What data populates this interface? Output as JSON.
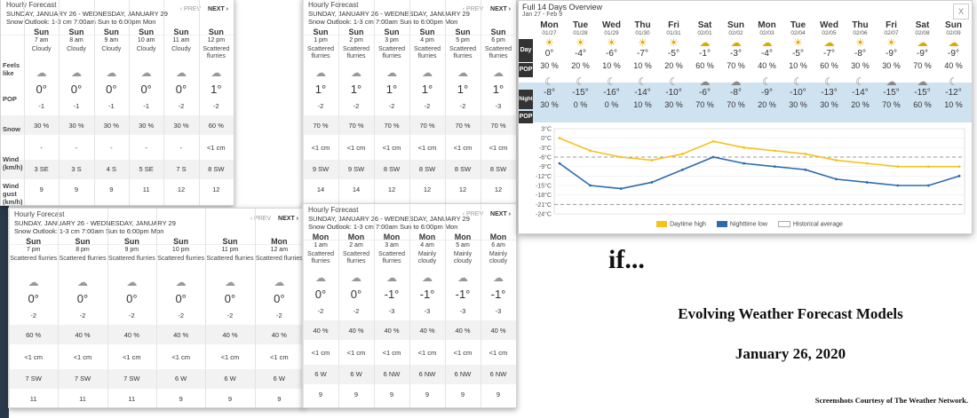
{
  "panels": [
    {
      "title": "Hourly Forecast",
      "dates": "SUNDAY, JANUARY 26 - WEDNESDAY, JANUARY 29",
      "outlook": "Snow Outlook: 1-3 cm 7:00am Sun to 6:00pm Mon",
      "prev": "‹ PREV",
      "next": "NEXT ›",
      "labels": {
        "feels": "Feels like",
        "pop": "POP",
        "snow": "Snow",
        "wind": "Wind (km/h)",
        "gust": "Wind gust (km/h)"
      },
      "hours": [
        {
          "day": "Sun",
          "time": "7 am",
          "cond": "Cloudy",
          "feels": "0°",
          "pop_val": "-1",
          "snow": "30 %",
          "snow2": "-",
          "wind": "3 SE",
          "gust": "9"
        },
        {
          "day": "Sun",
          "time": "8 am",
          "cond": "Cloudy",
          "feels": "0°",
          "pop_val": "-1",
          "snow": "30 %",
          "snow2": "-",
          "wind": "3 S",
          "gust": "9"
        },
        {
          "day": "Sun",
          "time": "9 am",
          "cond": "Cloudy",
          "feels": "0°",
          "pop_val": "-1",
          "snow": "30 %",
          "snow2": "-",
          "wind": "4 S",
          "gust": "9"
        },
        {
          "day": "Sun",
          "time": "10 am",
          "cond": "Cloudy",
          "feels": "0°",
          "pop_val": "-1",
          "snow": "30 %",
          "snow2": "-",
          "wind": "5 SE",
          "gust": "11"
        },
        {
          "day": "Sun",
          "time": "11 am",
          "cond": "Cloudy",
          "feels": "0°",
          "pop_val": "-2",
          "snow": "30 %",
          "snow2": "-",
          "wind": "7 S",
          "gust": "12"
        },
        {
          "day": "Sun",
          "time": "12 pm",
          "cond": "Scattered flurries",
          "feels": "1°",
          "pop_val": "-2",
          "snow": "60 %",
          "snow2": "<1 cm",
          "wind": "8 SW",
          "gust": "12"
        }
      ]
    },
    {
      "title": "Hourly Forecast",
      "dates": "SUNDAY, JANUARY 26 - WEDNESDAY, JANUARY 29",
      "outlook": "Snow Outlook: 1-3 cm 7:00am Sun to 6:00pm Mon",
      "prev": "‹ PREV",
      "next": "NEXT ›",
      "hours": [
        {
          "day": "Sun",
          "time": "1 pm",
          "cond": "Scattered flurries",
          "feels": "1°",
          "pop_val": "-2",
          "snow": "70 %",
          "snow2": "<1 cm",
          "wind": "9 SW",
          "gust": "14"
        },
        {
          "day": "Sun",
          "time": "2 pm",
          "cond": "Scattered flurries",
          "feels": "1°",
          "pop_val": "-2",
          "snow": "70 %",
          "snow2": "<1 cm",
          "wind": "9 SW",
          "gust": "14"
        },
        {
          "day": "Sun",
          "time": "3 pm",
          "cond": "Scattered flurries",
          "feels": "1°",
          "pop_val": "-2",
          "snow": "70 %",
          "snow2": "<1 cm",
          "wind": "8 SW",
          "gust": "12"
        },
        {
          "day": "Sun",
          "time": "4 pm",
          "cond": "Scattered flurries",
          "feels": "1°",
          "pop_val": "-2",
          "snow": "70 %",
          "snow2": "<1 cm",
          "wind": "8 SW",
          "gust": "12"
        },
        {
          "day": "Sun",
          "time": "5 pm",
          "cond": "Scattered flurries",
          "feels": "1°",
          "pop_val": "-2",
          "snow": "70 %",
          "snow2": "<1 cm",
          "wind": "8 SW",
          "gust": "12"
        },
        {
          "day": "Sun",
          "time": "6 pm",
          "cond": "Scattered flurries",
          "feels": "1°",
          "pop_val": "-3",
          "snow": "70 %",
          "snow2": "<1 cm",
          "wind": "8 SW",
          "gust": "12"
        }
      ]
    },
    {
      "title": "Hourly Forecast",
      "dates": "SUNDAY, JANUARY 26 - WEDNESDAY, JANUARY 29",
      "outlook": "Snow Outlook: 1-3 cm 7:00am Sun to 6:00pm Mon",
      "prev": "‹ PREV",
      "next": "NEXT ›",
      "hours": [
        {
          "day": "Sun",
          "time": "7 pm",
          "cond": "Scattered flurries",
          "feels": "0°",
          "pop_val": "-2",
          "snow": "60 %",
          "snow2": "<1 cm",
          "wind": "7 SW",
          "gust": "11"
        },
        {
          "day": "Sun",
          "time": "8 pm",
          "cond": "Scattered flurries",
          "feels": "0°",
          "pop_val": "-2",
          "snow": "40 %",
          "snow2": "<1 cm",
          "wind": "7 SW",
          "gust": "11"
        },
        {
          "day": "Sun",
          "time": "9 pm",
          "cond": "Scattered flurries",
          "feels": "0°",
          "pop_val": "-2",
          "snow": "40 %",
          "snow2": "<1 cm",
          "wind": "7 SW",
          "gust": "11"
        },
        {
          "day": "Sun",
          "time": "10 pm",
          "cond": "Scattered flurries",
          "feels": "0°",
          "pop_val": "-2",
          "snow": "40 %",
          "snow2": "<1 cm",
          "wind": "6 W",
          "gust": "9"
        },
        {
          "day": "Sun",
          "time": "11 pm",
          "cond": "Scattered flurries",
          "feels": "0°",
          "pop_val": "-2",
          "snow": "40 %",
          "snow2": "<1 cm",
          "wind": "6 W",
          "gust": "9"
        },
        {
          "day": "Mon",
          "time": "12 am",
          "cond": "Scattered flurries",
          "feels": "0°",
          "pop_val": "-2",
          "snow": "40 %",
          "snow2": "<1 cm",
          "wind": "6 W",
          "gust": "9"
        }
      ]
    },
    {
      "title": "Hourly Forecast",
      "dates": "SUNDAY, JANUARY 26 - WEDNESDAY, JANUARY 29",
      "outlook": "Snow Outlook: 1-3 cm 7:00am Sun to 6:00pm Mon",
      "prev": "‹ PREV",
      "next": "NEXT ›",
      "hours": [
        {
          "day": "Mon",
          "time": "1 am",
          "cond": "Scattered flurries",
          "feels": "0°",
          "pop_val": "-2",
          "snow": "40 %",
          "snow2": "<1 cm",
          "wind": "6 W",
          "gust": "9"
        },
        {
          "day": "Mon",
          "time": "2 am",
          "cond": "Scattered flurries",
          "feels": "0°",
          "pop_val": "-2",
          "snow": "40 %",
          "snow2": "<1 cm",
          "wind": "6 W",
          "gust": "9"
        },
        {
          "day": "Mon",
          "time": "3 am",
          "cond": "Scattered flurries",
          "feels": "-1°",
          "pop_val": "-3",
          "snow": "40 %",
          "snow2": "<1 cm",
          "wind": "6 NW",
          "gust": "9"
        },
        {
          "day": "Mon",
          "time": "4 am",
          "cond": "Mainly cloudy",
          "feels": "-1°",
          "pop_val": "-3",
          "snow": "40 %",
          "snow2": "<1 cm",
          "wind": "6 NW",
          "gust": "9"
        },
        {
          "day": "Mon",
          "time": "5 am",
          "cond": "Mainly cloudy",
          "feels": "-1°",
          "pop_val": "-3",
          "snow": "40 %",
          "snow2": "<1 cm",
          "wind": "6 NW",
          "gust": "9"
        },
        {
          "day": "Mon",
          "time": "6 am",
          "cond": "Mainly cloudy",
          "feels": "-1°",
          "pop_val": "-3",
          "snow": "40 %",
          "snow2": "<1 cm",
          "wind": "6 NW",
          "gust": "9"
        }
      ]
    }
  ],
  "overview": {
    "title": "Full 14 Days Overview",
    "range": "Jan 27 - Feb 9",
    "close": "X",
    "day_label": "Day",
    "pop_label": "POP",
    "night_label": "Night",
    "days": [
      {
        "day": "Mon",
        "date": "01/27",
        "high": "0°",
        "pop": "30 %",
        "low": "-8°",
        "npop": "30 %"
      },
      {
        "day": "Tue",
        "date": "01/28",
        "high": "-4°",
        "pop": "20 %",
        "low": "-15°",
        "npop": "0 %"
      },
      {
        "day": "Wed",
        "date": "01/29",
        "high": "-6°",
        "pop": "10 %",
        "low": "-16°",
        "npop": "0 %"
      },
      {
        "day": "Thu",
        "date": "01/30",
        "high": "-7°",
        "pop": "10 %",
        "low": "-14°",
        "npop": "10 %"
      },
      {
        "day": "Fri",
        "date": "01/31",
        "high": "-5°",
        "pop": "20 %",
        "low": "-10°",
        "npop": "30 %"
      },
      {
        "day": "Sat",
        "date": "02/01",
        "high": "-1°",
        "pop": "60 %",
        "low": "-6°",
        "npop": "70 %"
      },
      {
        "day": "Sun",
        "date": "02/02",
        "high": "-3°",
        "pop": "70 %",
        "low": "-8°",
        "npop": "70 %"
      },
      {
        "day": "Mon",
        "date": "02/03",
        "high": "-4°",
        "pop": "40 %",
        "low": "-9°",
        "npop": "20 %"
      },
      {
        "day": "Tue",
        "date": "02/04",
        "high": "-5°",
        "pop": "10 %",
        "low": "-10°",
        "npop": "30 %"
      },
      {
        "day": "Wed",
        "date": "02/05",
        "high": "-7°",
        "pop": "60 %",
        "low": "-13°",
        "npop": "30 %"
      },
      {
        "day": "Thu",
        "date": "02/06",
        "high": "-8°",
        "pop": "30 %",
        "low": "-14°",
        "npop": "20 %"
      },
      {
        "day": "Fri",
        "date": "02/07",
        "high": "-9°",
        "pop": "30 %",
        "low": "-15°",
        "npop": "70 %"
      },
      {
        "day": "Sat",
        "date": "02/08",
        "high": "-9°",
        "pop": "70 %",
        "low": "-15°",
        "npop": "60 %"
      },
      {
        "day": "Sun",
        "date": "02/09",
        "high": "-9°",
        "pop": "40 %",
        "low": "-12°",
        "npop": "10 %"
      }
    ]
  },
  "chart_data": {
    "type": "line",
    "x": [
      "01/27",
      "01/28",
      "01/29",
      "01/30",
      "01/31",
      "02/01",
      "02/02",
      "02/03",
      "02/04",
      "02/05",
      "02/06",
      "02/07",
      "02/08",
      "02/09"
    ],
    "series": [
      {
        "name": "Daytime high",
        "values": [
          0,
          -4,
          -6,
          -7,
          -5,
          -1,
          -3,
          -4,
          -5,
          -7,
          -8,
          -9,
          -9,
          -9
        ],
        "color": "#f5c21b"
      },
      {
        "name": "Nighttime low",
        "values": [
          -8,
          -15,
          -16,
          -14,
          -10,
          -6,
          -8,
          -9,
          -10,
          -13,
          -14,
          -15,
          -15,
          -12
        ],
        "color": "#2b6cb0"
      }
    ],
    "historical_average": {
      "name": "Historical average",
      "high": -6,
      "low": -21
    },
    "yticks": [
      "3°C",
      "0°C",
      "-3°C",
      "-6°C",
      "-9°C",
      "-12°C",
      "-15°C",
      "-18°C",
      "-21°C",
      "-24°C"
    ],
    "ylim": [
      -24,
      3
    ]
  },
  "text": {
    "if": "if...",
    "headline": "Evolving Weather Forecast Models",
    "date": "January 26, 2020",
    "credits": "Screenshots Courtesy of The Weather Network."
  }
}
